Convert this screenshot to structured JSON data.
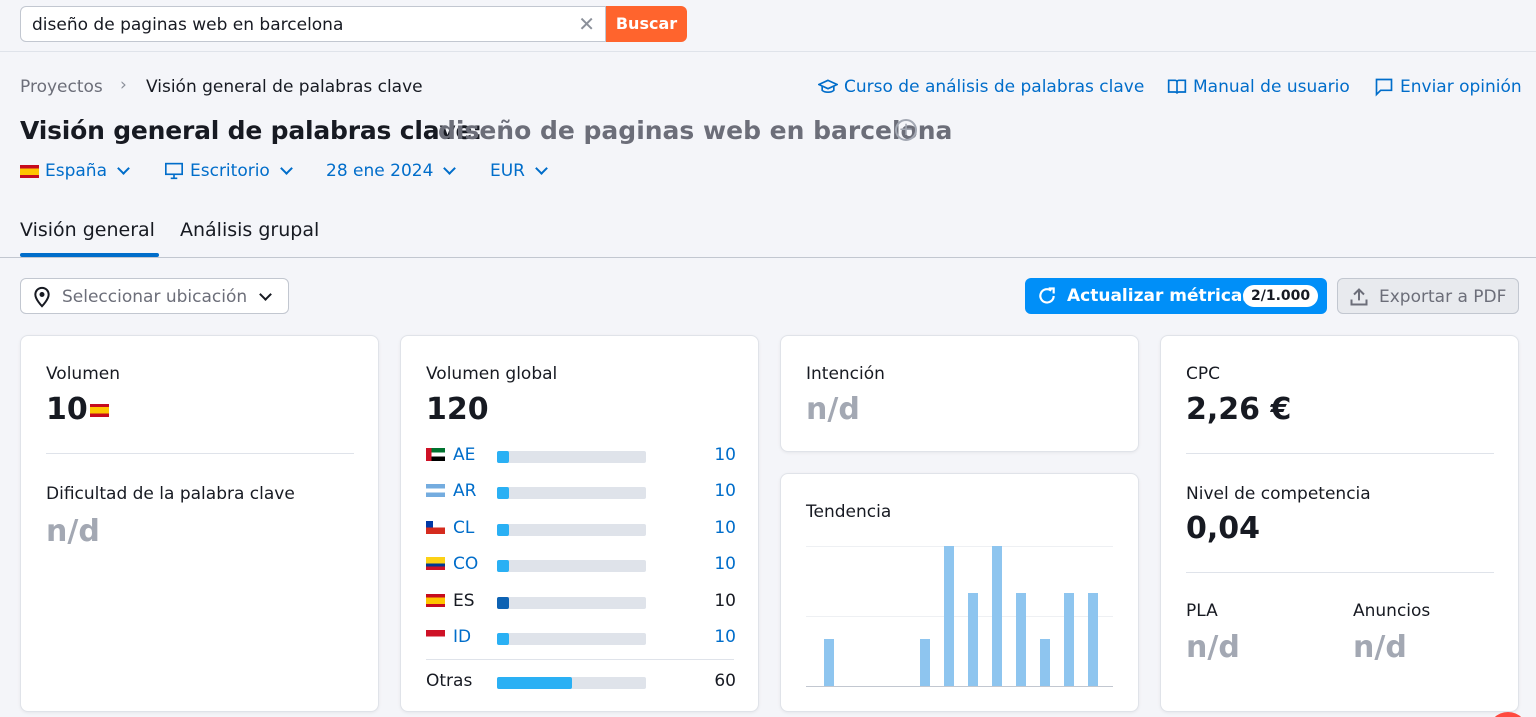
{
  "search": {
    "query": "diseño de paginas web en barcelona",
    "button_label": "Buscar"
  },
  "breadcrumb": {
    "root": "Proyectos",
    "current": "Visión general de palabras clave"
  },
  "header_links": {
    "course": "Curso de análisis de palabras clave",
    "manual": "Manual de usuario",
    "feedback": "Enviar opinión"
  },
  "title": {
    "prefix": "Visión general de palabras clave:",
    "keyword": "diseño de paginas web en barcelona"
  },
  "filters": {
    "country": "España",
    "device": "Escritorio",
    "date": "28 ene 2024",
    "currency": "EUR"
  },
  "tabs": {
    "overview": "Visión general",
    "group": "Análisis grupal"
  },
  "location_select": {
    "placeholder": "Seleccionar ubicación"
  },
  "update_button": {
    "label": "Actualizar métricas",
    "badge": "2/1.000"
  },
  "export_button": {
    "label": "Exportar a PDF"
  },
  "volume_card": {
    "volume_label": "Volumen",
    "volume_value": "10",
    "difficulty_label": "Dificultad de la palabra clave",
    "difficulty_value": "n/d"
  },
  "global_card": {
    "label": "Volumen global",
    "value": "120",
    "countries": [
      {
        "code": "AE",
        "value": "10",
        "share": 0.08,
        "flag": "ae",
        "highlight": false
      },
      {
        "code": "AR",
        "value": "10",
        "share": 0.08,
        "flag": "ar",
        "highlight": false
      },
      {
        "code": "CL",
        "value": "10",
        "share": 0.08,
        "flag": "cl",
        "highlight": false
      },
      {
        "code": "CO",
        "value": "10",
        "share": 0.08,
        "flag": "co",
        "highlight": false
      },
      {
        "code": "ES",
        "value": "10",
        "share": 0.08,
        "flag": "es",
        "highlight": true
      },
      {
        "code": "ID",
        "value": "10",
        "share": 0.08,
        "flag": "id",
        "highlight": false
      }
    ],
    "others": {
      "label": "Otras",
      "value": "60",
      "share": 0.5
    }
  },
  "intent_card": {
    "label": "Intención",
    "value": "n/d"
  },
  "trend_card": {
    "label": "Tendencia"
  },
  "chart_data": {
    "type": "bar",
    "values": [
      1,
      0,
      0,
      0,
      1,
      3,
      2,
      3,
      2,
      1,
      2,
      2
    ],
    "ylim": [
      0,
      3
    ]
  },
  "cpc_card": {
    "cpc_label": "CPC",
    "cpc_value": "2,26 €",
    "competition_label": "Nivel de competencia",
    "competition_value": "0,04",
    "pla_label": "PLA",
    "pla_value": "n/d",
    "ads_label": "Anuncios",
    "ads_value": "n/d"
  },
  "colors": {
    "accent": "#006dca",
    "primary_button": "#008ff8",
    "search_button": "#ff642d",
    "bar": "#2ab0f4",
    "trend_bar": "#8ec5ef"
  }
}
